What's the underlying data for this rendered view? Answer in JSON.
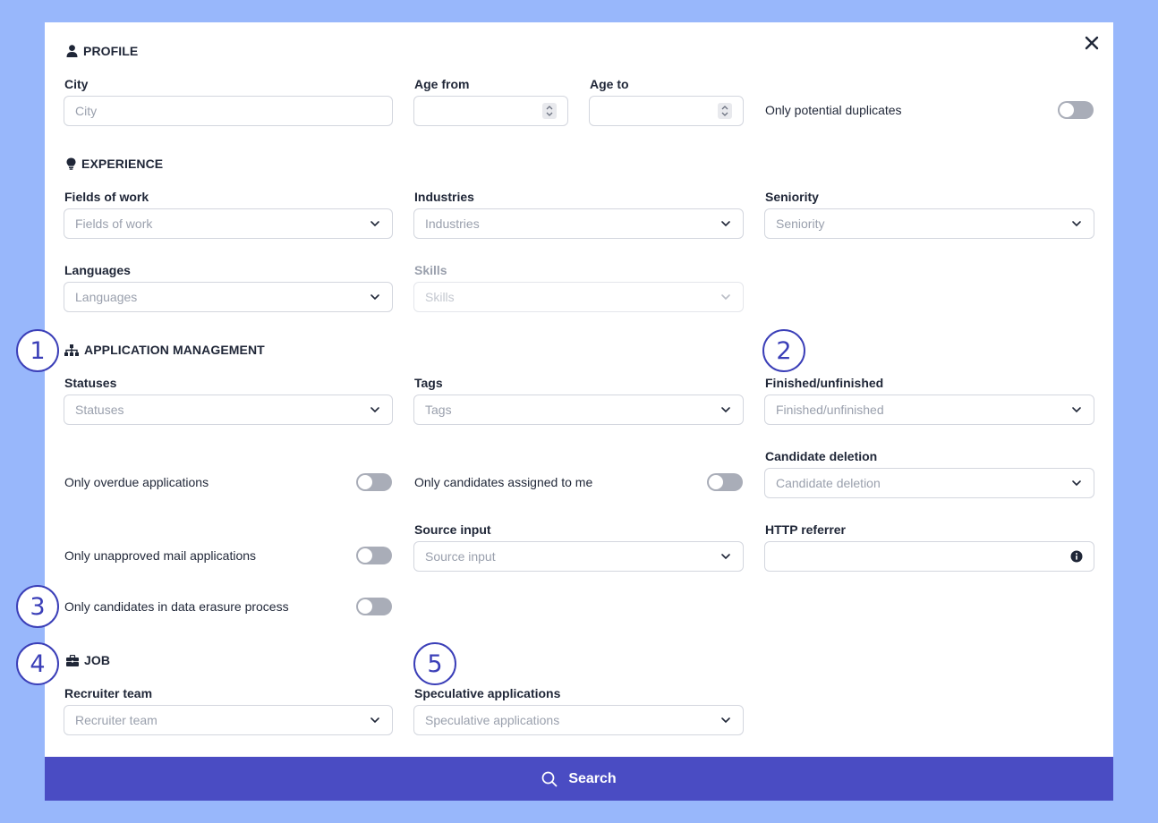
{
  "close_icon": "close-icon",
  "profile": {
    "title": "PROFILE",
    "icon": "user-icon",
    "city": {
      "label": "City",
      "placeholder": "City",
      "value": ""
    },
    "age_from": {
      "label": "Age from",
      "value": ""
    },
    "age_to": {
      "label": "Age to",
      "value": ""
    },
    "only_potential_duplicates": {
      "label": "Only potential duplicates",
      "on": false
    }
  },
  "experience": {
    "title": "EXPERIENCE",
    "icon": "lightbulb-icon",
    "fields_of_work": {
      "label": "Fields of work",
      "placeholder": "Fields of work"
    },
    "industries": {
      "label": "Industries",
      "placeholder": "Industries"
    },
    "seniority": {
      "label": "Seniority",
      "placeholder": "Seniority"
    },
    "languages": {
      "label": "Languages",
      "placeholder": "Languages"
    },
    "skills": {
      "label": "Skills",
      "placeholder": "Skills",
      "disabled": true
    }
  },
  "application_management": {
    "title": "APPLICATION MANAGEMENT",
    "icon": "sitemap-icon",
    "statuses": {
      "label": "Statuses",
      "placeholder": "Statuses"
    },
    "tags": {
      "label": "Tags",
      "placeholder": "Tags"
    },
    "finished_unfinished": {
      "label": "Finished/unfinished",
      "placeholder": "Finished/unfinished"
    },
    "only_overdue": {
      "label": "Only overdue applications",
      "on": false
    },
    "only_assigned_to_me": {
      "label": "Only candidates assigned to me",
      "on": false
    },
    "candidate_deletion": {
      "label": "Candidate deletion",
      "placeholder": "Candidate deletion"
    },
    "only_unapproved_mail": {
      "label": "Only unapproved mail applications",
      "on": false
    },
    "source_input": {
      "label": "Source input",
      "placeholder": "Source input"
    },
    "http_referrer": {
      "label": "HTTP referrer",
      "value": ""
    },
    "only_data_erasure": {
      "label": "Only candidates in data erasure process",
      "on": false
    }
  },
  "job": {
    "title": "JOB",
    "icon": "briefcase-icon",
    "recruiter_team": {
      "label": "Recruiter team",
      "placeholder": "Recruiter team"
    },
    "speculative_applications": {
      "label": "Speculative applications",
      "placeholder": "Speculative applications"
    }
  },
  "markers": [
    "1",
    "2",
    "3",
    "4",
    "5"
  ],
  "search_button": {
    "label": "Search",
    "icon": "search-icon"
  },
  "colors": {
    "background": "#98b7fb",
    "primary": "#4a4cc3",
    "marker": "#3b3fb8",
    "toggle_off": "#a9adb8"
  }
}
